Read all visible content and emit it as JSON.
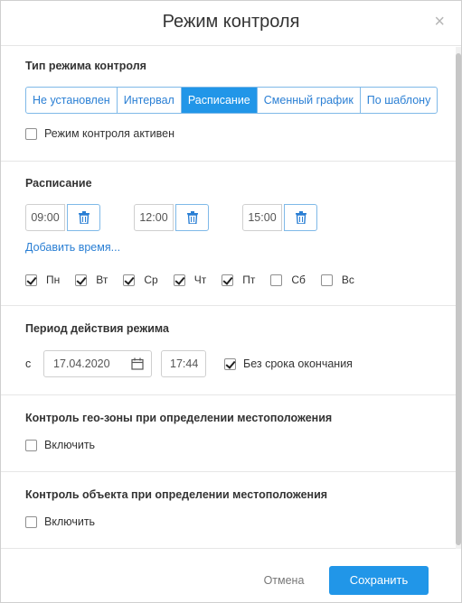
{
  "dialog": {
    "title": "Режим контроля",
    "close_glyph": "×"
  },
  "mode_type": {
    "title": "Тип режима контроля",
    "options": [
      "Не установлен",
      "Интервал",
      "Расписание",
      "Сменный график",
      "По шаблону"
    ],
    "selected": "Расписание",
    "active_label": "Режим контроля активен",
    "active_checked": false
  },
  "schedule": {
    "title": "Расписание",
    "times": [
      "09:00",
      "12:00",
      "15:00"
    ],
    "add_time_label": "Добавить время...",
    "days": [
      {
        "label": "Пн",
        "checked": true
      },
      {
        "label": "Вт",
        "checked": true
      },
      {
        "label": "Ср",
        "checked": true
      },
      {
        "label": "Чт",
        "checked": true
      },
      {
        "label": "Пт",
        "checked": true
      },
      {
        "label": "Сб",
        "checked": false
      },
      {
        "label": "Вс",
        "checked": false
      }
    ]
  },
  "period": {
    "title": "Период действия режима",
    "from_label": "с",
    "date": "17.04.2020",
    "time": "17:44",
    "no_end_label": "Без срока окончания",
    "no_end_checked": true
  },
  "geozone": {
    "title": "Контроль гео-зоны при определении местоположения",
    "enable_label": "Включить",
    "enabled": false
  },
  "object_control": {
    "title": "Контроль объекта при определении местоположения",
    "enable_label": "Включить",
    "enabled": false
  },
  "footer": {
    "cancel_label": "Отмена",
    "save_label": "Сохранить"
  },
  "colors": {
    "accent": "#2196e8",
    "link": "#2a7fd4"
  },
  "icons": {
    "trash": "trash-icon",
    "calendar": "calendar-icon",
    "close": "close-icon"
  }
}
